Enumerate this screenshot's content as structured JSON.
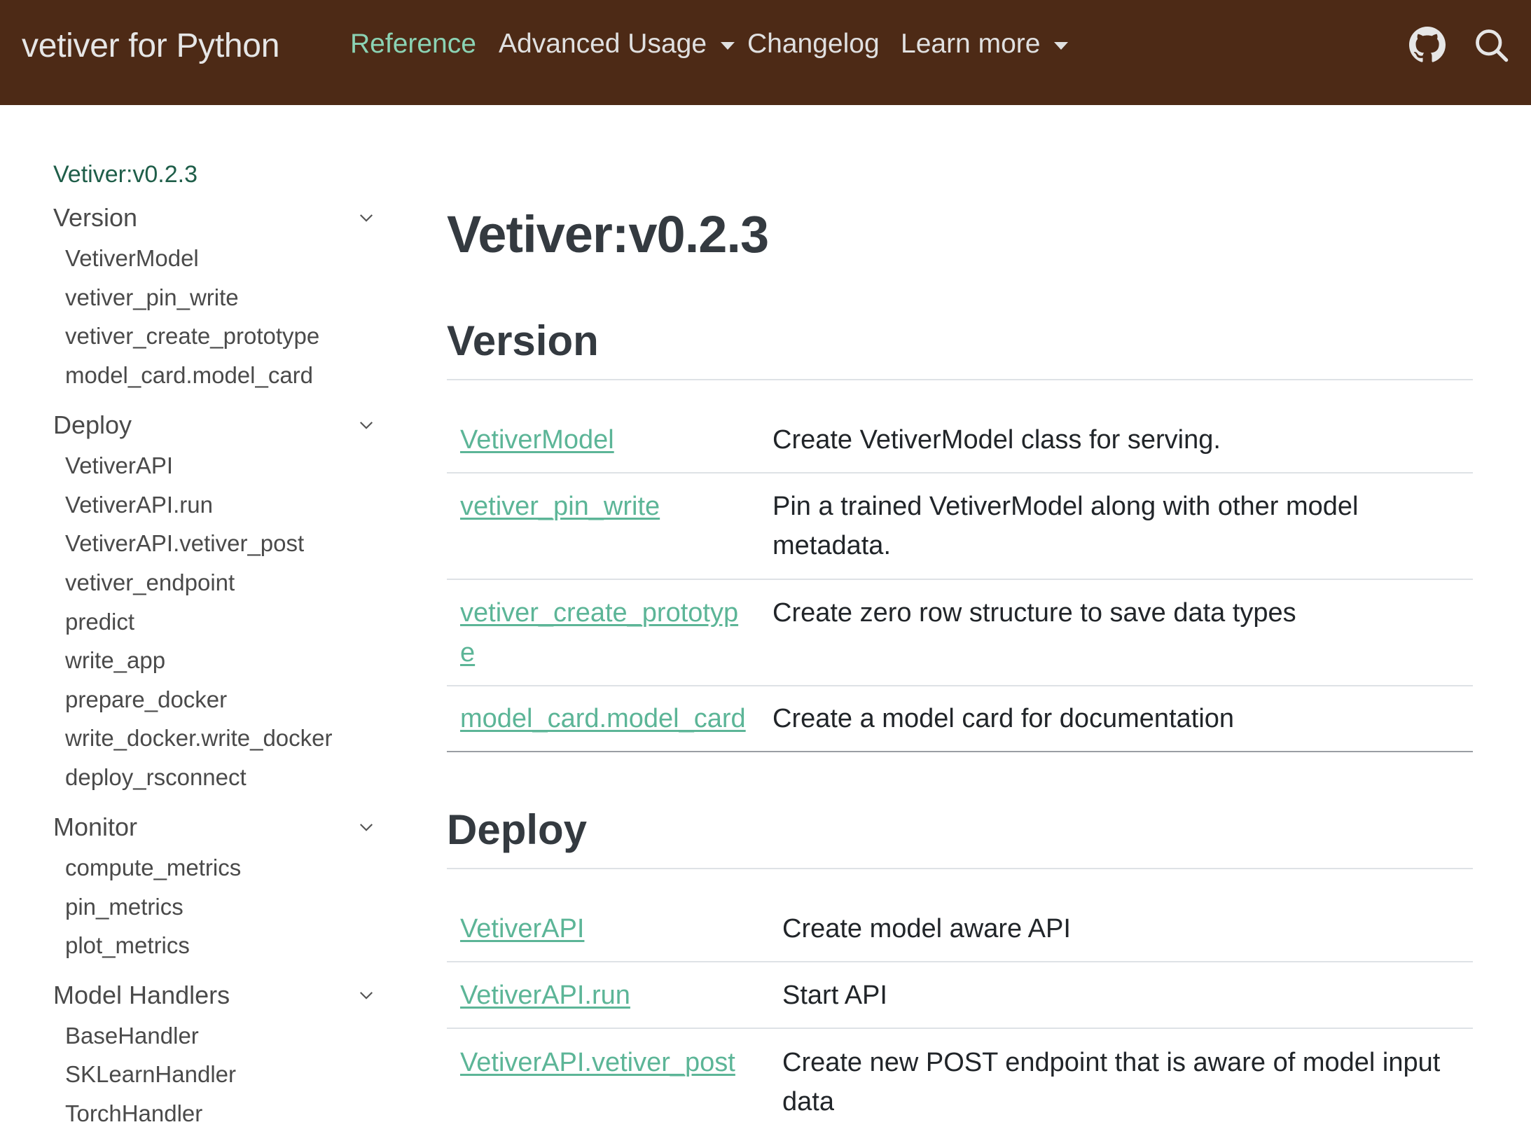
{
  "navbar": {
    "brand": "vetiver for Python",
    "items": [
      {
        "label": "Reference",
        "active": true,
        "dropdown": false
      },
      {
        "label": "Advanced Usage",
        "active": false,
        "dropdown": true
      },
      {
        "label": "Changelog",
        "active": false,
        "dropdown": false
      },
      {
        "label": "Learn more",
        "active": false,
        "dropdown": true
      }
    ],
    "icons": [
      "github-icon",
      "search-icon"
    ],
    "background": "#4d2a16",
    "active_color": "#8bd3b4"
  },
  "sidebar": {
    "top": "Vetiver:v0.2.3",
    "sections": [
      {
        "label": "Version",
        "items": [
          "VetiverModel",
          "vetiver_pin_write",
          "vetiver_create_prototype",
          "model_card.model_card"
        ]
      },
      {
        "label": "Deploy",
        "items": [
          "VetiverAPI",
          "VetiverAPI.run",
          "VetiverAPI.vetiver_post",
          "vetiver_endpoint",
          "predict",
          "write_app",
          "prepare_docker",
          "write_docker.write_docker",
          "deploy_rsconnect"
        ]
      },
      {
        "label": "Monitor",
        "items": [
          "compute_metrics",
          "pin_metrics",
          "plot_metrics"
        ]
      },
      {
        "label": "Model Handlers",
        "items": [
          "BaseHandler",
          "SKLearnHandler",
          "TorchHandler"
        ]
      }
    ]
  },
  "main": {
    "title": "Vetiver:v0.2.3",
    "sections": [
      {
        "heading": "Version",
        "rows": [
          {
            "name": "VetiverModel",
            "desc": "Create VetiverModel class for serving."
          },
          {
            "name": "vetiver_pin_write",
            "desc_lines": [
              "Pin a trained VetiverModel along with other model",
              "metadata."
            ]
          },
          {
            "name_lines": [
              "vetiver_create_prototyp",
              "e"
            ],
            "desc": "Create zero row structure to save data types"
          },
          {
            "name": "model_card.model_card",
            "desc": "Create a model card for documentation"
          }
        ]
      },
      {
        "heading": "Deploy",
        "rows": [
          {
            "name": "VetiverAPI",
            "desc": "Create model aware API"
          },
          {
            "name": "VetiverAPI.run",
            "desc": "Start API"
          },
          {
            "name": "VetiverAPI.vetiver_post",
            "desc_lines": [
              "Create new POST endpoint that is aware of model input",
              "data"
            ]
          }
        ]
      }
    ],
    "link_color": "#5cb597"
  }
}
